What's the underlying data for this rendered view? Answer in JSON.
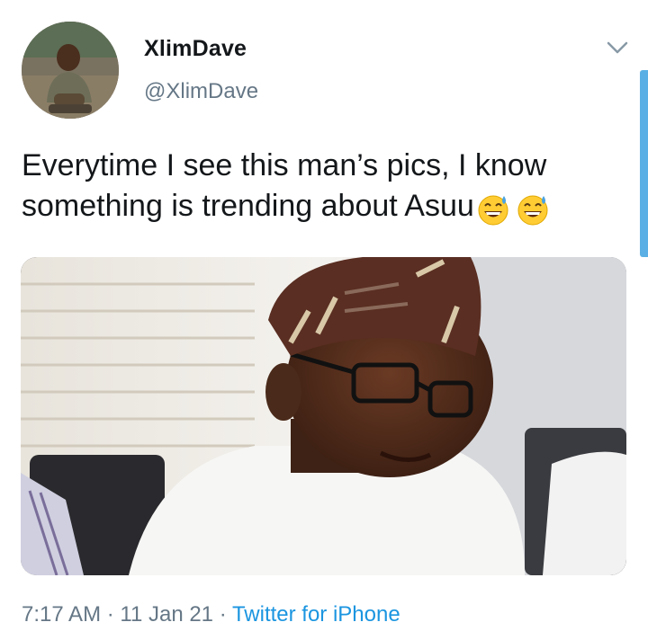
{
  "tweet": {
    "display_name": "XlimDave",
    "handle": "@XlimDave",
    "text": "Everytime I see this man’s pics, I know something is trending about Asuu",
    "emojis": [
      "grinning-sweat-emoji",
      "grinning-sweat-emoji"
    ],
    "time": "7:17 AM",
    "separator": " · ",
    "date": "11 Jan 21",
    "source": "Twitter for iPhone"
  },
  "icons": {
    "caret": "chevron-down-icon",
    "avatar": "avatar"
  },
  "colors": {
    "text_primary": "#14171a",
    "text_secondary": "#657786",
    "link": "#1b95e0"
  }
}
